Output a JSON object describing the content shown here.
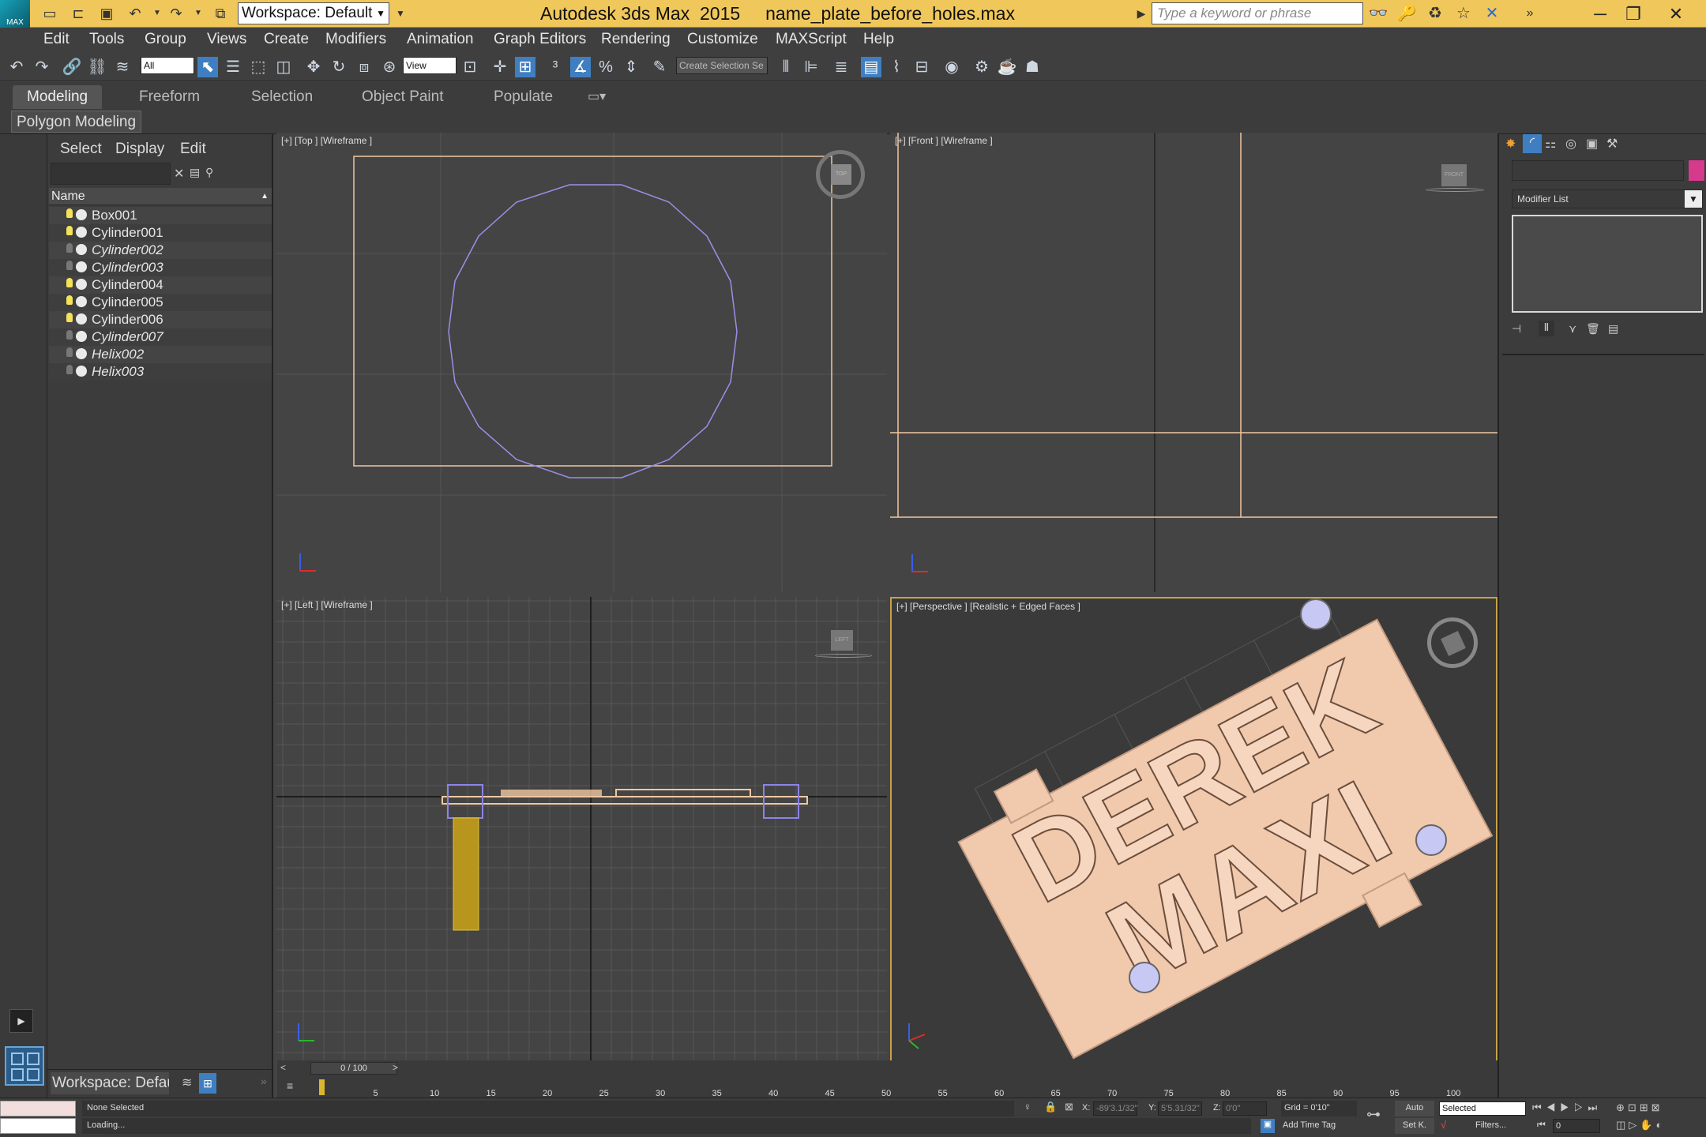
{
  "titlebar": {
    "workspace": "Workspace: Default",
    "app": "Autodesk 3ds Max  2015",
    "file": "name_plate_before_holes.max",
    "search_placeholder": "Type a keyword or phrase",
    "logo": "MAX"
  },
  "menu": [
    "Edit",
    "Tools",
    "Group",
    "Views",
    "Create",
    "Modifiers",
    "Animation",
    "Graph Editors",
    "Rendering",
    "Customize",
    "MAXScript",
    "Help"
  ],
  "toolbar": {
    "selection_filter": "All",
    "ref_coord": "View",
    "named_selection": "Create Selection Se"
  },
  "ribbon": {
    "tabs": [
      "Modeling",
      "Freeform",
      "Selection",
      "Object Paint",
      "Populate"
    ],
    "active_tab": "Modeling",
    "panel": "Polygon Modeling"
  },
  "explorer": {
    "tabs": [
      "Select",
      "Display",
      "Edit"
    ],
    "column": "Name",
    "objects": [
      {
        "name": "Box001",
        "light": true,
        "italic": false
      },
      {
        "name": "Cylinder001",
        "light": true,
        "italic": false
      },
      {
        "name": "Cylinder002",
        "light": false,
        "italic": true
      },
      {
        "name": "Cylinder003",
        "light": false,
        "italic": true
      },
      {
        "name": "Cylinder004",
        "light": true,
        "italic": false
      },
      {
        "name": "Cylinder005",
        "light": true,
        "italic": false
      },
      {
        "name": "Cylinder006",
        "light": true,
        "italic": false
      },
      {
        "name": "Cylinder007",
        "light": false,
        "italic": true
      },
      {
        "name": "Helix002",
        "light": false,
        "italic": true
      },
      {
        "name": "Helix003",
        "light": false,
        "italic": true
      }
    ],
    "workspace": "Workspace: Defau"
  },
  "viewports": {
    "top": "[+] [Top ] [Wireframe ]",
    "front": "[+] [Front ] [Wireframe ]",
    "left": "[+] [Left ] [Wireframe ]",
    "perspective": "[+] [Perspective ] [Realistic + Edged Faces ]",
    "cube_top": "TOP",
    "cube_front": "FRONT",
    "cube_left": "LEFT",
    "plate_line1": "DEREK",
    "plate_line2": "MAXI"
  },
  "command_panel": {
    "modifier_list": "Modifier List",
    "object_color": "#d63a8c"
  },
  "timeline": {
    "frame": "0 / 100",
    "ticks": [
      0,
      5,
      10,
      15,
      20,
      25,
      30,
      35,
      40,
      45,
      50,
      55,
      60,
      65,
      70,
      75,
      80,
      85,
      90,
      95,
      100
    ]
  },
  "status": {
    "selection": "None Selected",
    "prompt": "Loading...",
    "x_label": "X:",
    "x": "-89'3.1/32\"",
    "y_label": "Y:",
    "y": "5'5.31/32\"",
    "z_label": "Z:",
    "z": "0'0\"",
    "grid": "Grid = 0'10\"",
    "add_time_tag": "Add Time Tag",
    "auto": "Auto",
    "set_key": "Set K.",
    "key_filter": "Selected",
    "filters": "Filters...",
    "frame_value": "0"
  }
}
